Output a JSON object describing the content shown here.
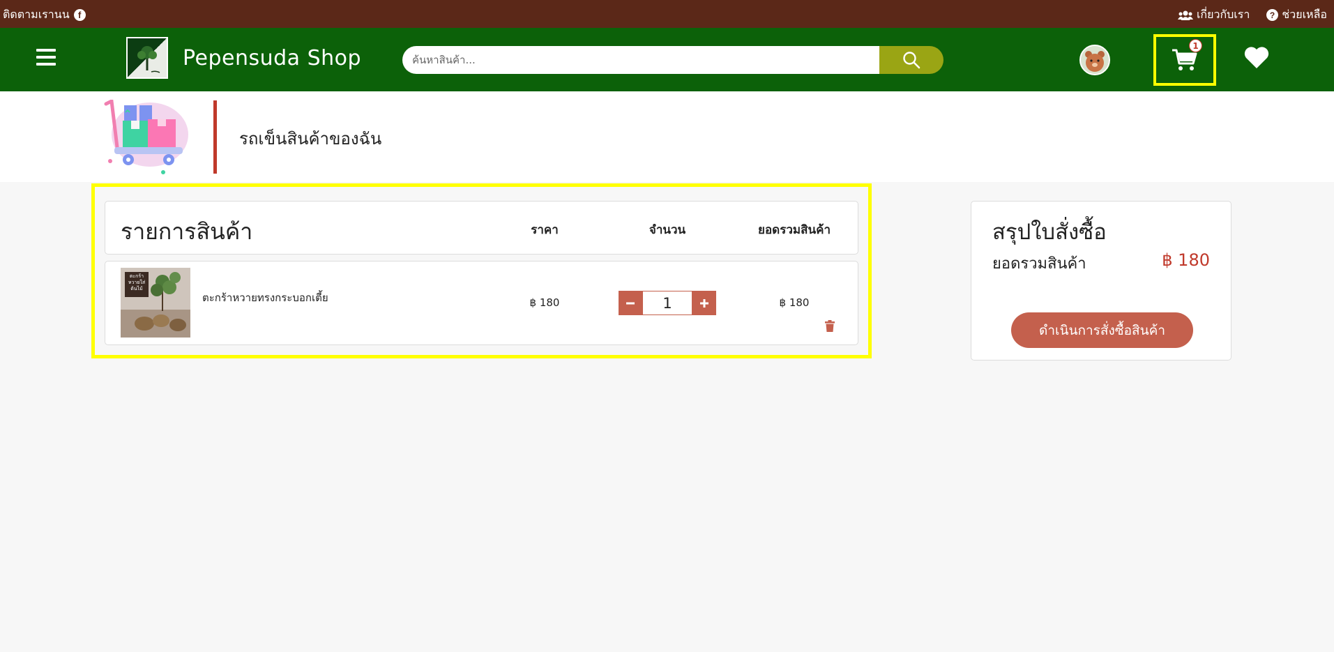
{
  "topbar": {
    "follow_text": "ติดตามเรานน",
    "about_label": "เกี่ยวกับเรา",
    "help_label": "ช่วยเหลือ"
  },
  "header": {
    "shop_name": "Pepensuda Shop",
    "search_placeholder": "ค้นหาสินค้า...",
    "cart_count": "1"
  },
  "page": {
    "title": "รถเข็นสินค้าของฉัน"
  },
  "cart": {
    "heading": "รายการสินค้า",
    "columns": {
      "price": "ราคา",
      "quantity": "จำนวน",
      "total": "ยอดรวมสินค้า"
    },
    "items": [
      {
        "name": "ตะกร้าหวายทรงกระบอกเตี้ย",
        "price": "฿ 180",
        "quantity": "1",
        "total": "฿ 180",
        "image_caption": "ตะกร้าหวายใส่ต้นไม้"
      }
    ]
  },
  "summary": {
    "title": "สรุปใบสั่งซื้อ",
    "subtotal_label": "ยอดรวมสินค้า",
    "subtotal_value": "฿ 180",
    "checkout_label": "ดำเนินการสั่งซื้อสินค้า"
  },
  "colors": {
    "topbar": "#5b2818",
    "header": "#0c6109",
    "search_button": "#9aa514",
    "accent": "#c4604d",
    "price_red": "#c0392b",
    "highlight": "#ffff00"
  }
}
